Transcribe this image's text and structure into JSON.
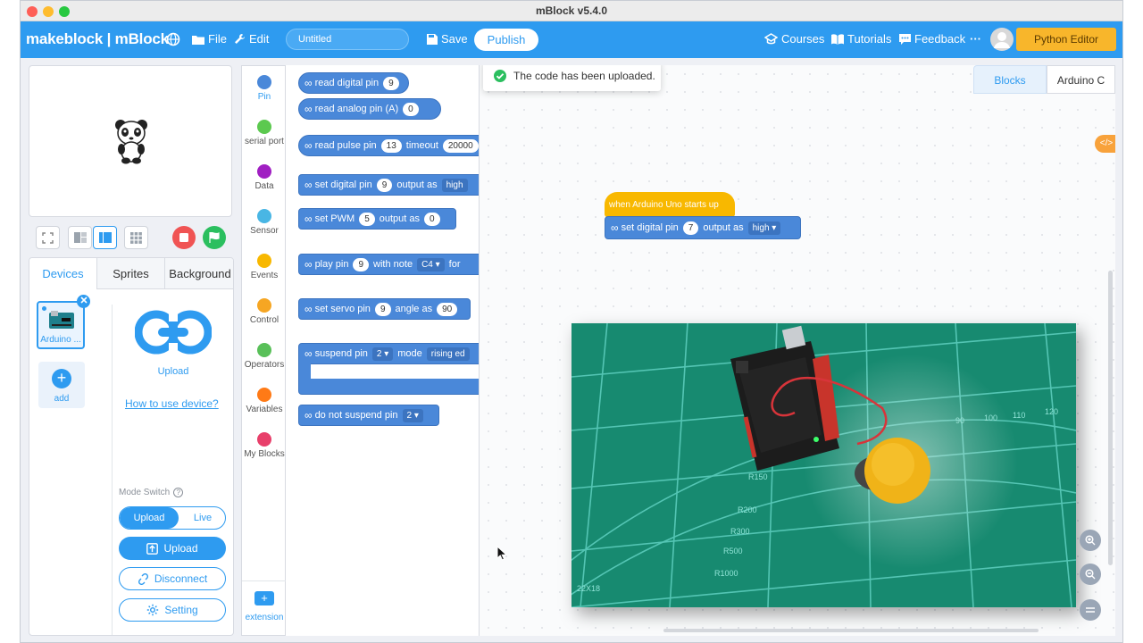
{
  "window": {
    "title": "mBlock v5.4.0"
  },
  "menubar": {
    "brand": "makeblock | mBlock",
    "file": "File",
    "edit": "Edit",
    "project_name": "Untitled",
    "save": "Save",
    "publish": "Publish",
    "courses": "Courses",
    "tutorials": "Tutorials",
    "feedback": "Feedback",
    "more": "···",
    "python_editor": "Python Editor"
  },
  "device_tabs": [
    "Devices",
    "Sprites",
    "Background"
  ],
  "devices": {
    "device_name": "Arduino ...",
    "add_label": "add",
    "upload_icon_label": "Upload",
    "how_to": "How to use device?",
    "mode_switch_label": "Mode Switch",
    "mode_upload": "Upload",
    "mode_live": "Live",
    "upload_button": "Upload",
    "disconnect_button": "Disconnect",
    "setting_button": "Setting"
  },
  "categories": [
    {
      "label": "Pin",
      "color": "#4a88d9"
    },
    {
      "label": "serial port",
      "color": "#5cc94f"
    },
    {
      "label": "Data",
      "color": "#a01fc2"
    },
    {
      "label": "Sensor",
      "color": "#49b6e4"
    },
    {
      "label": "Events",
      "color": "#f8b800"
    },
    {
      "label": "Control",
      "color": "#f6a623"
    },
    {
      "label": "Operators",
      "color": "#59c059"
    },
    {
      "label": "Variables",
      "color": "#ff7a16"
    },
    {
      "label": "My Blocks",
      "color": "#e83f6a"
    }
  ],
  "extension_label": "extension",
  "blocks": {
    "read_digital": {
      "text": "read digital pin",
      "val": "9"
    },
    "read_analog": {
      "text": "read analog pin  (A)",
      "val": "0"
    },
    "read_pulse": {
      "text": "read pulse pin",
      "val": "13",
      "text2": "timeout",
      "val2": "20000"
    },
    "set_digital": {
      "text": "set digital pin",
      "val": "9",
      "text2": "output as",
      "val2": "high"
    },
    "set_pwm": {
      "text": "set PWM",
      "val": "5",
      "text2": "output as",
      "val2": "0"
    },
    "play_pin": {
      "text": "play pin",
      "val": "9",
      "text2": "with note",
      "val2": "C4 ▾",
      "text3": "for"
    },
    "set_servo": {
      "text": "set servo pin",
      "val": "9",
      "text2": "angle as",
      "val2": "90"
    },
    "suspend_pin": {
      "text": "suspend pin",
      "val": "2 ▾",
      "text2": "mode",
      "val2": "rising ed"
    },
    "do_not_suspend": {
      "text": "do not suspend pin",
      "val": "2 ▾"
    }
  },
  "script": {
    "tab_blocks": "Blocks",
    "tab_arduino": "Arduino C",
    "toast": "The code has been uploaded.",
    "hat": "when Arduino Uno starts up",
    "block_text": "set digital pin",
    "block_val": "7",
    "block_text2": "output as",
    "block_val2": "high ▾",
    "code_toggle": "</>"
  },
  "photo": {
    "ruler_labels": [
      "90",
      "100",
      "110",
      "120",
      "R150",
      "R200",
      "R300",
      "R500",
      "R1000",
      "22X18"
    ]
  }
}
